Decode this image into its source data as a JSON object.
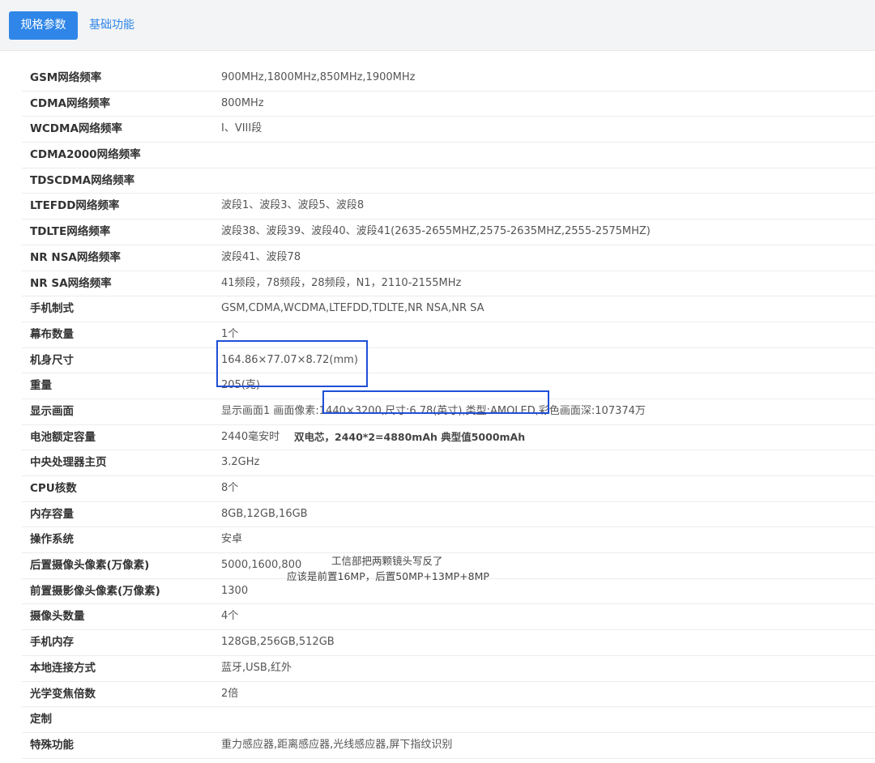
{
  "tabs": {
    "specs": "规格参数",
    "basic": "基础功能"
  },
  "rows": [
    {
      "k": "GSM网络频率",
      "v": "900MHz,1800MHz,850MHz,1900MHz"
    },
    {
      "k": "CDMA网络频率",
      "v": "800MHz"
    },
    {
      "k": "WCDMA网络频率",
      "v": "I、VIII段"
    },
    {
      "k": "CDMA2000网络频率",
      "v": ""
    },
    {
      "k": "TDSCDMA网络频率",
      "v": ""
    },
    {
      "k": "LTEFDD网络频率",
      "v": "波段1、波段3、波段5、波段8"
    },
    {
      "k": "TDLTE网络频率",
      "v": "波段38、波段39、波段40、波段41(2635-2655MHZ,2575-2635MHZ,2555-2575MHZ)"
    },
    {
      "k": "NR NSA网络频率",
      "v": "波段41、波段78"
    },
    {
      "k": "NR SA网络频率",
      "v": "41频段，78频段，28频段，N1，2110-2155MHz"
    },
    {
      "k": "手机制式",
      "v": "GSM,CDMA,WCDMA,LTEFDD,TDLTE,NR NSA,NR SA"
    },
    {
      "k": "幕布数量",
      "v": "1个"
    },
    {
      "k": "机身尺寸",
      "v": "164.86×77.07×8.72(mm)"
    },
    {
      "k": "重量",
      "v": "205(克)"
    },
    {
      "k": "显示画面",
      "v": "显示画面1 画面像素:1440×3200,尺寸:6.78(英寸),类型:AMOLED,彩色画面深:107374万"
    },
    {
      "k": "电池额定容量",
      "v": "2440毫安时"
    },
    {
      "k": "中央处理器主页",
      "v": "3.2GHz"
    },
    {
      "k": "CPU核数",
      "v": "8个"
    },
    {
      "k": "内存容量",
      "v": "8GB,12GB,16GB"
    },
    {
      "k": "操作系统",
      "v": "安卓"
    },
    {
      "k": "后置摄像头像素(万像素)",
      "v": "5000,1600,800"
    },
    {
      "k": "前置摄影像头像素(万像素)",
      "v": "1300"
    },
    {
      "k": "摄像头数量",
      "v": "4个"
    },
    {
      "k": "手机内存",
      "v": "128GB,256GB,512GB"
    },
    {
      "k": "本地连接方式",
      "v": "蓝牙,USB,红外"
    },
    {
      "k": "光学变焦倍数",
      "v": "2倍"
    },
    {
      "k": "定制",
      "v": ""
    },
    {
      "k": "特殊功能",
      "v": "重力感应器,距离感应器,光线感应器,屏下指纹识别"
    }
  ],
  "annotations": {
    "battery_note": "双电芯，2440*2=4880mAh 典型值5000mAh",
    "camera_note_1": "工信部把两颗镜头写反了",
    "camera_note_2": "应该是前置16MP，后置50MP+13MP+8MP",
    "box_color": "#1f4fd8"
  },
  "colors": {
    "accent": "#2f86e8",
    "annotation": "#1f4fd8"
  }
}
